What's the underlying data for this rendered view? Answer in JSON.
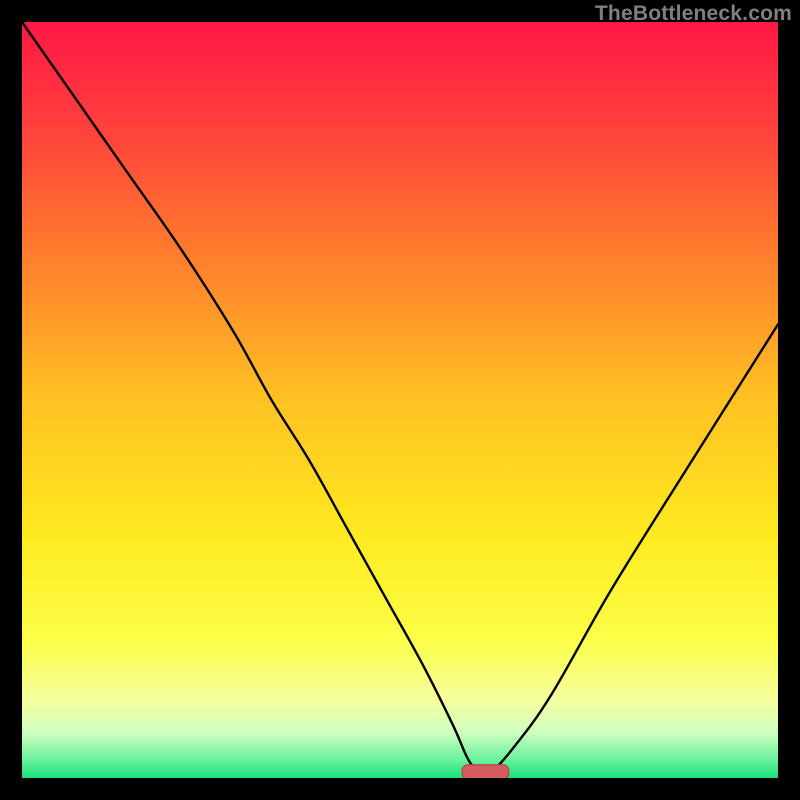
{
  "watermark": "TheBottleneck.com",
  "colors": {
    "black": "#000000",
    "watermark_text": "#7f7f7f",
    "line": "#000000",
    "marker_fill": "#d55c5c",
    "marker_stroke": "#b94848",
    "gradient_stops": [
      {
        "offset": 0.0,
        "color": "#ff1846"
      },
      {
        "offset": 0.12,
        "color": "#ff3a3e"
      },
      {
        "offset": 0.3,
        "color": "#ff7a2e"
      },
      {
        "offset": 0.5,
        "color": "#ffc122"
      },
      {
        "offset": 0.68,
        "color": "#ffea20"
      },
      {
        "offset": 0.82,
        "color": "#fcff4a"
      },
      {
        "offset": 0.9,
        "color": "#f4ffa2"
      },
      {
        "offset": 0.94,
        "color": "#cfffc0"
      },
      {
        "offset": 0.975,
        "color": "#6cf2a0"
      },
      {
        "offset": 1.0,
        "color": "#19e07c"
      }
    ]
  },
  "chart_data": {
    "type": "line",
    "title": "",
    "xlabel": "",
    "ylabel": "",
    "xlim": [
      0,
      100
    ],
    "ylim": [
      0,
      100
    ],
    "grid": false,
    "legend": false,
    "series": [
      {
        "name": "bottleneck-curve",
        "x": [
          0,
          7,
          14,
          21,
          28,
          33,
          38,
          43,
          48,
          53,
          57,
          59,
          60.5,
          62,
          65,
          70,
          78,
          88,
          100
        ],
        "y": [
          100,
          90,
          80,
          70,
          59,
          50,
          42,
          33,
          24,
          15,
          7,
          2.5,
          0.8,
          0.8,
          4,
          11,
          25,
          41,
          60
        ]
      }
    ],
    "marker": {
      "name": "sweet-spot",
      "x": 61.3,
      "y": 0.8,
      "width": 6.2,
      "height": 1.9
    }
  }
}
